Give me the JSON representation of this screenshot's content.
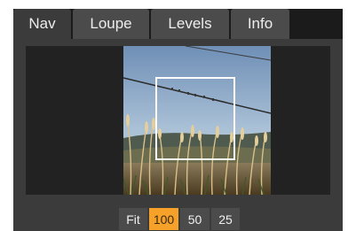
{
  "tabs": [
    {
      "label": "Nav",
      "active": true
    },
    {
      "label": "Loupe",
      "active": false
    },
    {
      "label": "Levels",
      "active": false
    },
    {
      "label": "Info",
      "active": false
    }
  ],
  "zoom": {
    "options": [
      "Fit",
      "100",
      "50",
      "25"
    ],
    "selected": "100",
    "accent_color": "#f5a12a"
  },
  "colors": {
    "tab_bg": "#4b4b4b",
    "tab_active_bg": "#3b3b3b",
    "panel_bg": "#3b3b3b",
    "viewport_bg": "#222222",
    "text": "#ededed"
  }
}
